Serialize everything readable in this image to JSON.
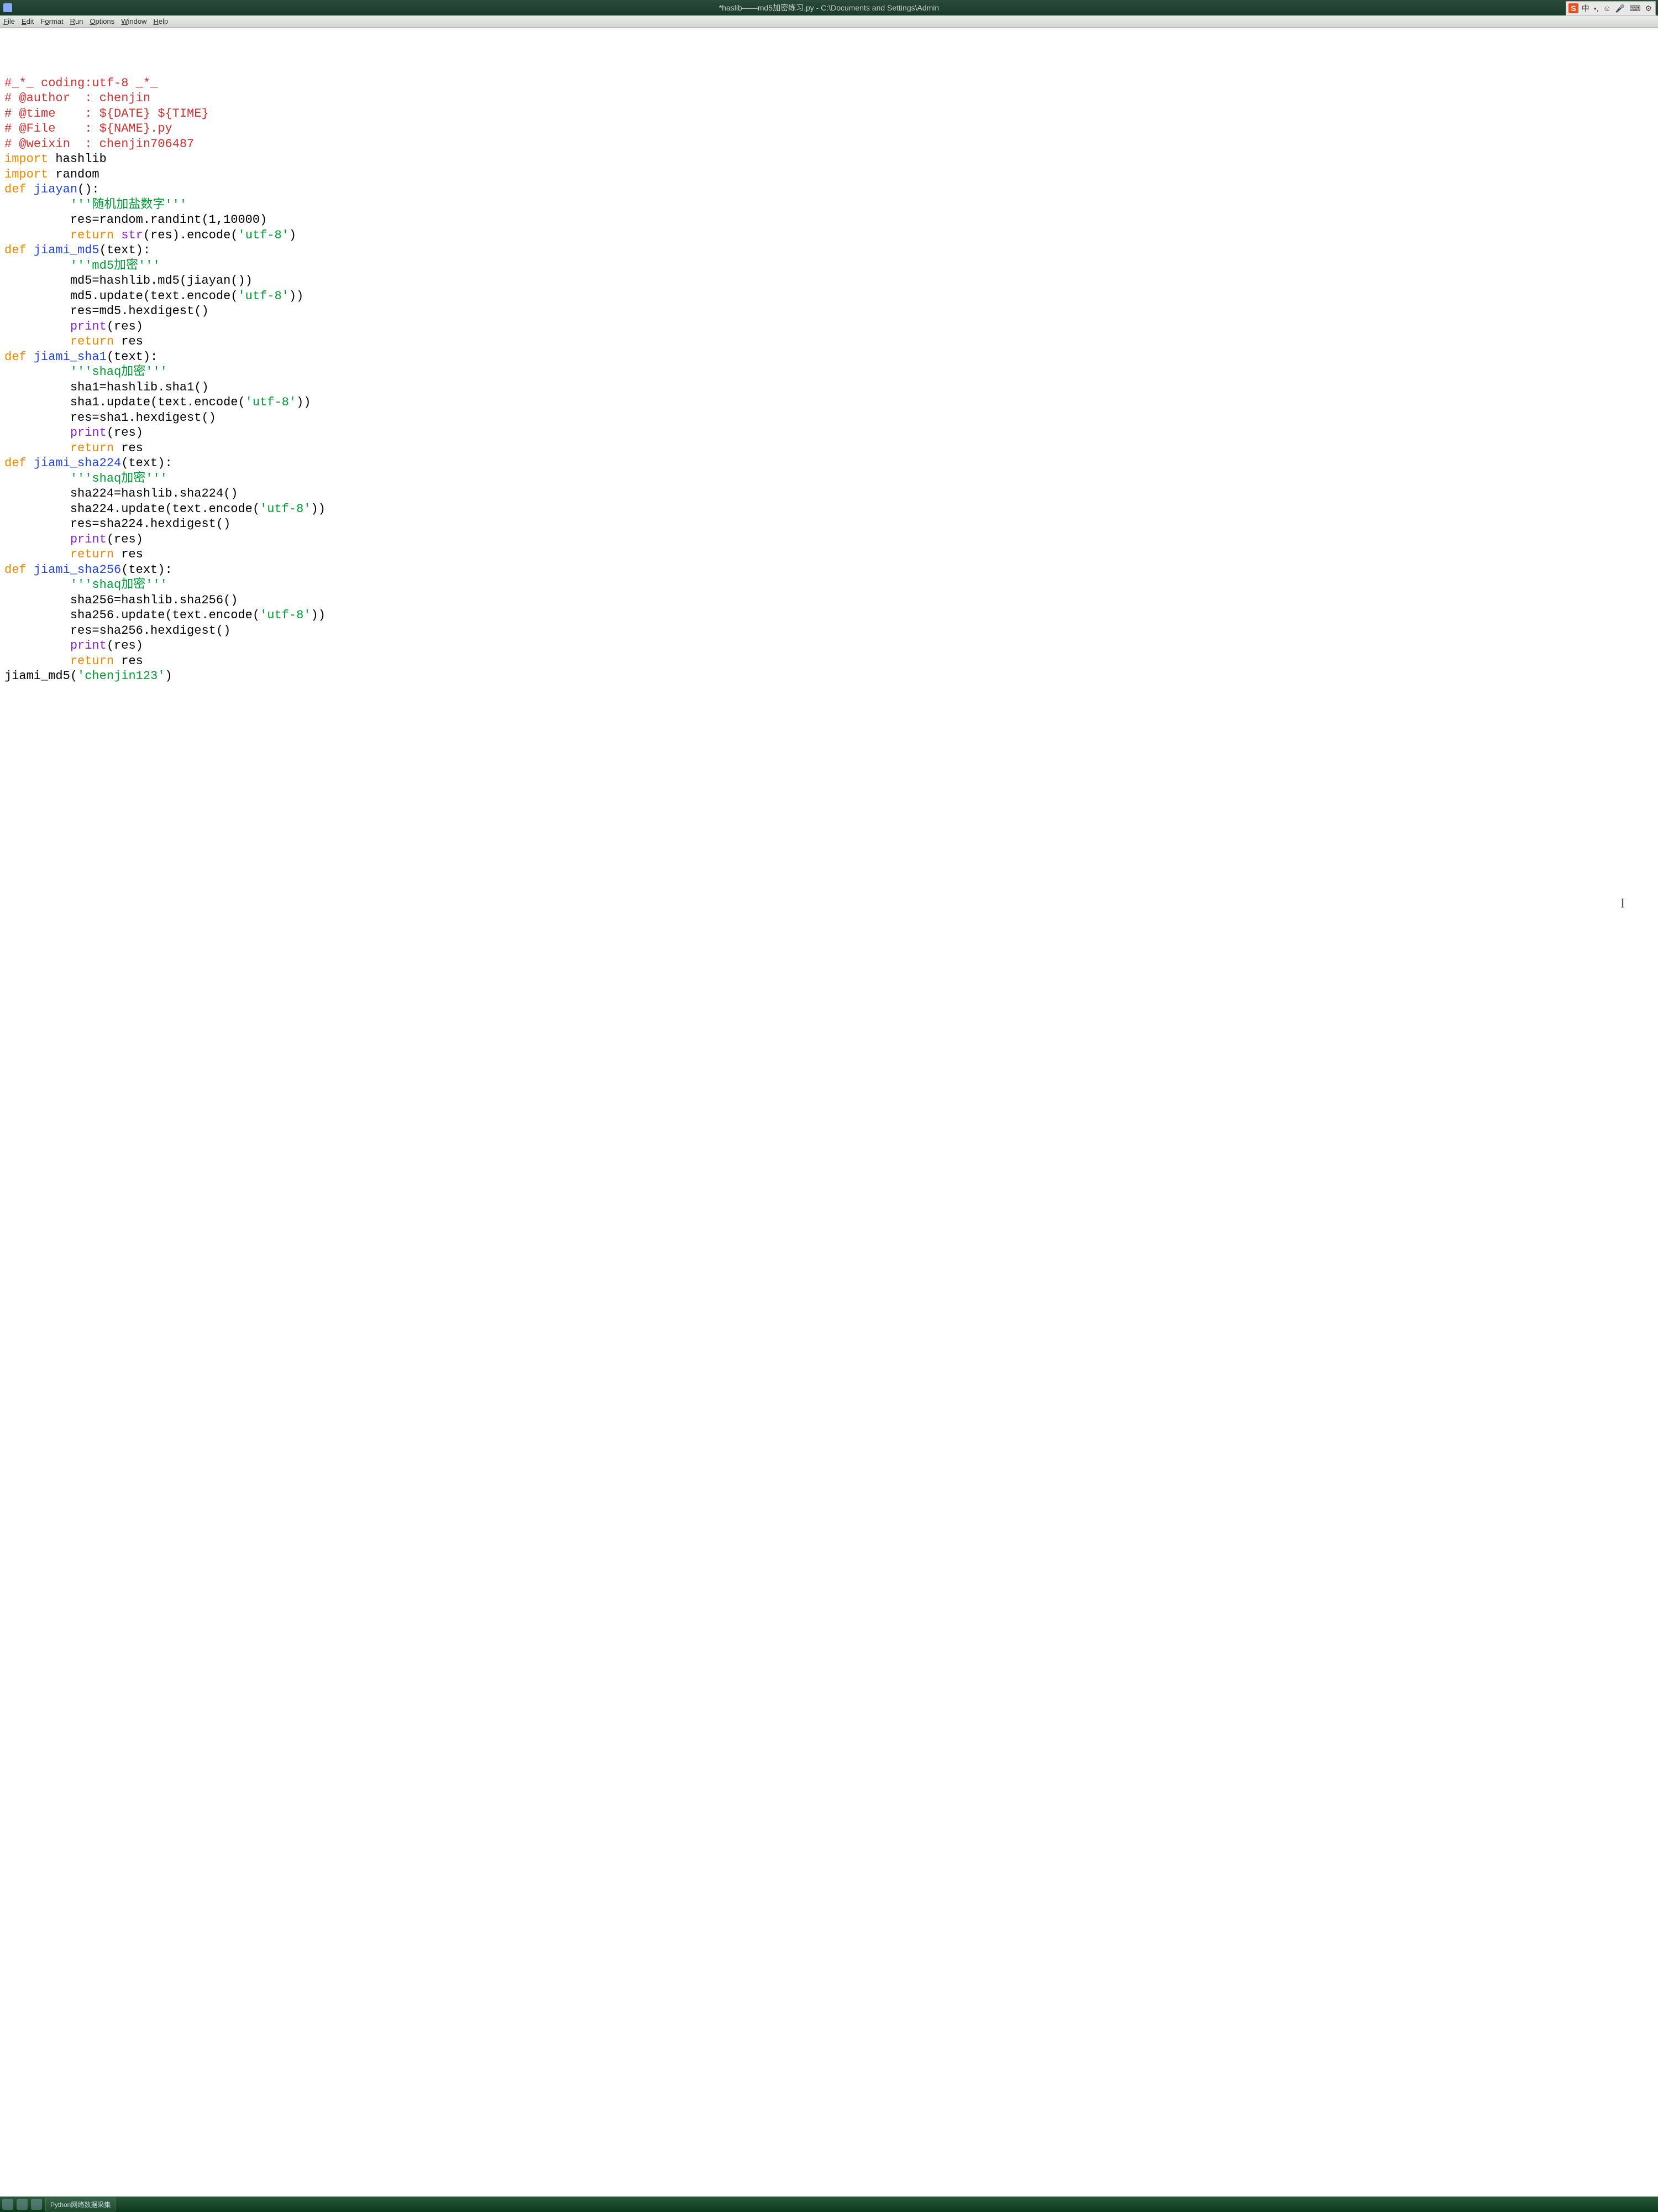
{
  "titlebar": {
    "text": "*haslib——md5加密练习.py - C:\\Documents and Settings\\Admin"
  },
  "ime": {
    "logo": "S",
    "items": [
      "中",
      "•,",
      "☺",
      "🎤",
      "⌨",
      "⚙"
    ]
  },
  "menu": {
    "file": "File",
    "edit": "Edit",
    "format": "Format",
    "run": "Run",
    "options": "Options",
    "window": "Window",
    "help": "Help"
  },
  "code": {
    "lines": [
      [
        [
          "comment",
          "#_*_ coding:utf-8 _*_"
        ]
      ],
      [
        [
          "comment",
          "# @author  : chenjin"
        ]
      ],
      [
        [
          "comment",
          "# @time    : ${DATE} ${TIME}"
        ]
      ],
      [
        [
          "comment",
          "# @File    : ${NAME}.py"
        ]
      ],
      [
        [
          "comment",
          "# @weixin  : chenjin706487"
        ]
      ],
      [
        [
          "keyword",
          "import"
        ],
        [
          "text",
          " hashlib"
        ]
      ],
      [
        [
          "keyword",
          "import"
        ],
        [
          "text",
          " random"
        ]
      ],
      [
        [
          "keyword",
          "def"
        ],
        [
          "text",
          " "
        ],
        [
          "def",
          "jiayan"
        ],
        [
          "text",
          "():"
        ]
      ],
      [
        [
          "text",
          "         "
        ],
        [
          "string",
          "'''随机加盐数字'''"
        ]
      ],
      [
        [
          "text",
          "         res=random.randint(1,10000)"
        ]
      ],
      [
        [
          "text",
          "         "
        ],
        [
          "keyword",
          "return"
        ],
        [
          "text",
          " "
        ],
        [
          "builtin",
          "str"
        ],
        [
          "text",
          "(res).encode("
        ],
        [
          "string",
          "'utf-8'"
        ],
        [
          "text",
          ")"
        ]
      ],
      [
        [
          "keyword",
          "def"
        ],
        [
          "text",
          " "
        ],
        [
          "def",
          "jiami_md5"
        ],
        [
          "text",
          "(text):"
        ]
      ],
      [
        [
          "text",
          "         "
        ],
        [
          "string",
          "'''md5加密'''"
        ]
      ],
      [
        [
          "text",
          "         md5=hashlib.md5(jiayan())"
        ]
      ],
      [
        [
          "text",
          "         md5.update(text.encode("
        ],
        [
          "string",
          "'utf-8'"
        ],
        [
          "text",
          "))"
        ]
      ],
      [
        [
          "text",
          "         res=md5.hexdigest()"
        ]
      ],
      [
        [
          "text",
          "         "
        ],
        [
          "builtin",
          "print"
        ],
        [
          "text",
          "(res)"
        ]
      ],
      [
        [
          "text",
          "         "
        ],
        [
          "keyword",
          "return"
        ],
        [
          "text",
          " res"
        ]
      ],
      [
        [
          "keyword",
          "def"
        ],
        [
          "text",
          " "
        ],
        [
          "def",
          "jiami_sha1"
        ],
        [
          "text",
          "(text):"
        ]
      ],
      [
        [
          "text",
          "         "
        ],
        [
          "string",
          "'''shaq加密'''"
        ]
      ],
      [
        [
          "text",
          "         sha1=hashlib.sha1()"
        ]
      ],
      [
        [
          "text",
          "         sha1.update(text.encode("
        ],
        [
          "string",
          "'utf-8'"
        ],
        [
          "text",
          "))"
        ]
      ],
      [
        [
          "text",
          "         res=sha1.hexdigest()"
        ]
      ],
      [
        [
          "text",
          "         "
        ],
        [
          "builtin",
          "print"
        ],
        [
          "text",
          "(res)"
        ]
      ],
      [
        [
          "text",
          "         "
        ],
        [
          "keyword",
          "return"
        ],
        [
          "text",
          " res"
        ]
      ],
      [
        [
          "keyword",
          "def"
        ],
        [
          "text",
          " "
        ],
        [
          "def",
          "jiami_sha224"
        ],
        [
          "text",
          "(text):"
        ]
      ],
      [
        [
          "text",
          "         "
        ],
        [
          "string",
          "'''shaq加密'''"
        ]
      ],
      [
        [
          "text",
          "         sha224=hashlib.sha224()"
        ]
      ],
      [
        [
          "text",
          "         sha224.update(text.encode("
        ],
        [
          "string",
          "'utf-8'"
        ],
        [
          "text",
          "))"
        ]
      ],
      [
        [
          "text",
          "         res=sha224.hexdigest()"
        ]
      ],
      [
        [
          "text",
          "         "
        ],
        [
          "builtin",
          "print"
        ],
        [
          "text",
          "(res)"
        ]
      ],
      [
        [
          "text",
          "         "
        ],
        [
          "keyword",
          "return"
        ],
        [
          "text",
          " res"
        ]
      ],
      [
        [
          "keyword",
          "def"
        ],
        [
          "text",
          " "
        ],
        [
          "def",
          "jiami_sha256"
        ],
        [
          "text",
          "(text):"
        ]
      ],
      [
        [
          "text",
          "         "
        ],
        [
          "string",
          "'''shaq加密'''"
        ]
      ],
      [
        [
          "text",
          "         sha256=hashlib.sha256()"
        ]
      ],
      [
        [
          "text",
          "         sha256.update(text.encode("
        ],
        [
          "string",
          "'utf-8'"
        ],
        [
          "text",
          "))"
        ]
      ],
      [
        [
          "text",
          "         res=sha256.hexdigest()"
        ]
      ],
      [
        [
          "text",
          "         "
        ],
        [
          "builtin",
          "print"
        ],
        [
          "text",
          "(res)"
        ]
      ],
      [
        [
          "text",
          "         "
        ],
        [
          "keyword",
          "return"
        ],
        [
          "text",
          " res"
        ]
      ],
      [
        [
          "text",
          "jiami_md5("
        ],
        [
          "string",
          "'chenjin123'"
        ],
        [
          "text",
          ")"
        ]
      ]
    ]
  },
  "taskbar": {
    "items": [
      "Python网络数据采集"
    ]
  }
}
